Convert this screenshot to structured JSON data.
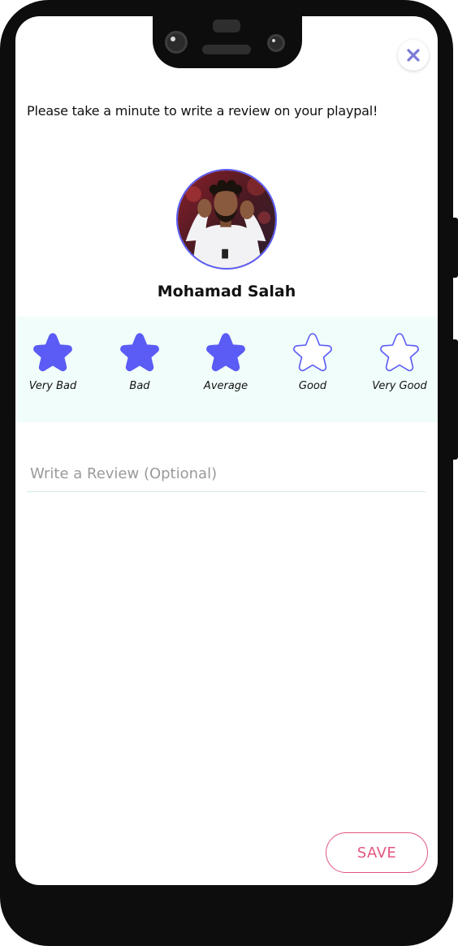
{
  "header": {
    "close_icon": "close-icon",
    "prompt": "Please take a minute to write a review on your playpal!"
  },
  "player": {
    "name": "Mohamad Salah",
    "avatar_icon": "avatar-photo"
  },
  "rating": {
    "value": 3,
    "max": 5,
    "options": [
      {
        "label": "Very Bad",
        "selected": true
      },
      {
        "label": "Bad",
        "selected": true
      },
      {
        "label": "Average",
        "selected": true
      },
      {
        "label": "Good",
        "selected": false
      },
      {
        "label": "Very Good",
        "selected": false
      }
    ]
  },
  "review": {
    "placeholder": "Write a Review (Optional)",
    "value": ""
  },
  "actions": {
    "save_label": "SAVE"
  },
  "colors": {
    "accent": "#5b5bf5",
    "save": "#e0577e",
    "band": "#f1fdfa",
    "close": "#7a7ad6"
  }
}
